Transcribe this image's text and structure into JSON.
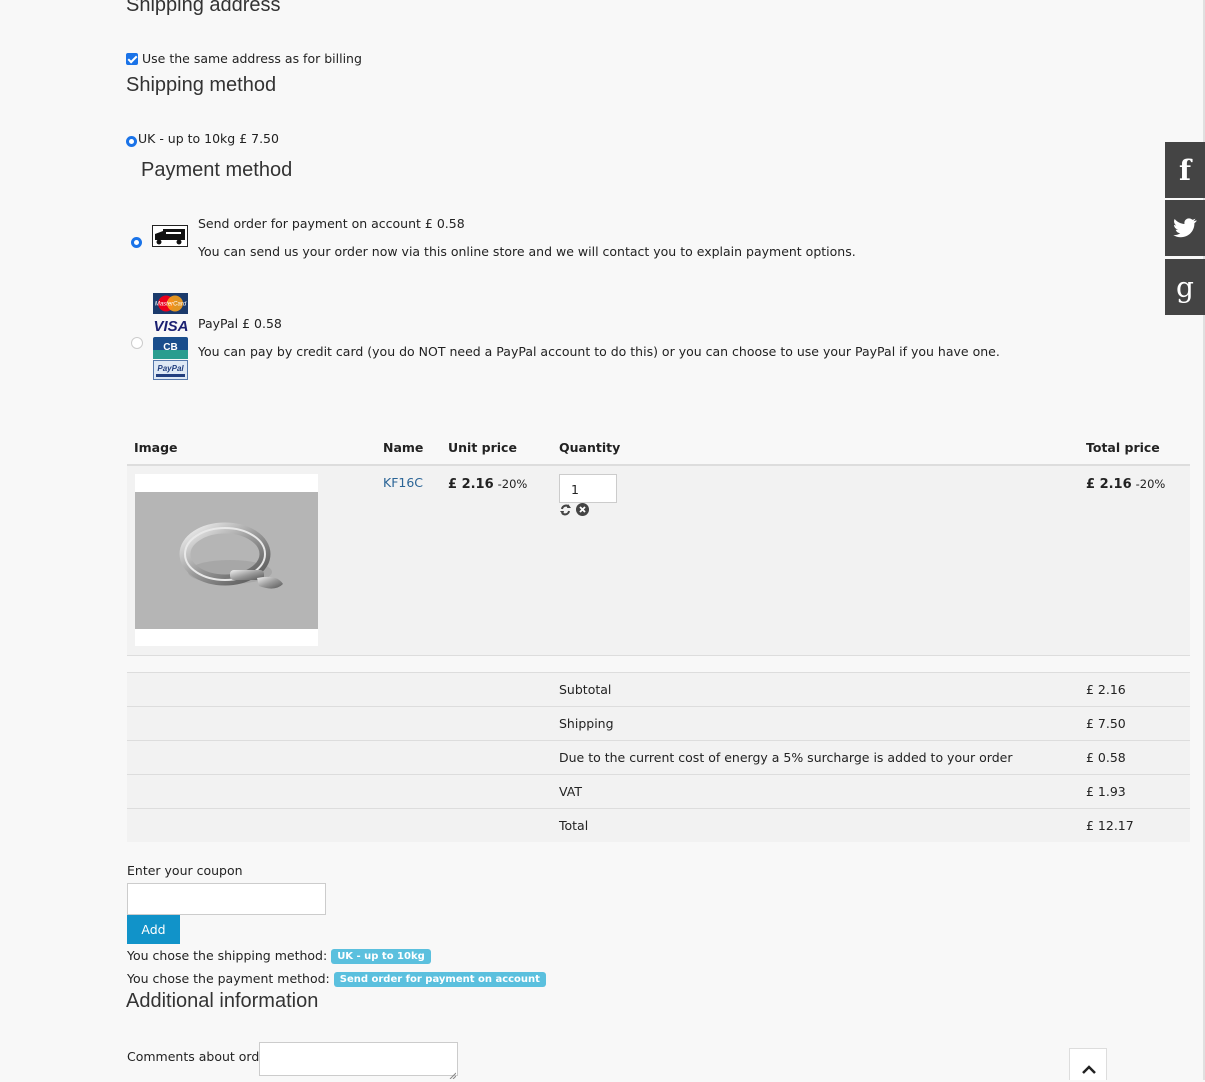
{
  "shipping_address": {
    "heading": "Shipping address",
    "same_as_billing_label": "Use the same address as for billing",
    "same_as_billing_checked": true
  },
  "shipping_method": {
    "heading": "Shipping method",
    "option_label": "UK - up to 10kg £ 7.50",
    "selected": true
  },
  "payment_method": {
    "heading": "Payment method",
    "options": [
      {
        "title": "Send order for payment on account £ 0.58",
        "description": "You can send us your order now via this online store and we will contact you to explain payment options.",
        "icon": "truck-icon",
        "selected": true
      },
      {
        "title": "PayPal £ 0.58",
        "description": "You can pay by credit card (you do NOT need a PayPal account to do this) or you can choose to use your PayPal if you have one.",
        "icons": [
          "mastercard-logo",
          "visa-logo",
          "cb-card-logo",
          "paypal-logo"
        ],
        "logo_text": {
          "mastercard": "MasterCard",
          "visa": "VISA",
          "cb": "CB",
          "paypal": "PayPal"
        },
        "selected": false
      }
    ]
  },
  "cart": {
    "headers": {
      "image": "Image",
      "name": "Name",
      "unit_price": "Unit price",
      "quantity": "Quantity",
      "total_price": "Total price"
    },
    "items": [
      {
        "name": "KF16C",
        "unit_price": "£ 2.16",
        "unit_discount": "-20%",
        "quantity": "1",
        "total_price": "£ 2.16",
        "total_discount": "-20%",
        "icons": [
          "refresh-icon",
          "remove-icon"
        ]
      }
    ],
    "totals": [
      {
        "label": "Subtotal",
        "value": "£ 2.16"
      },
      {
        "label": "Shipping",
        "value": "£ 7.50"
      },
      {
        "label": "Due to the current cost of energy a 5% surcharge is added to your order",
        "value": "£ 0.58"
      },
      {
        "label": "VAT",
        "value": "£ 1.93"
      },
      {
        "label": "Total",
        "value": "£ 12.17"
      }
    ]
  },
  "coupon": {
    "label": "Enter your coupon",
    "value": "",
    "add_button": "Add"
  },
  "summary": {
    "shipping_prefix": "You chose the shipping method:",
    "shipping_badge": "UK - up to 10kg",
    "payment_prefix": "You chose the payment method:",
    "payment_badge": "Send order for payment on account"
  },
  "additional": {
    "heading": "Additional information",
    "comments_label": "Comments about order",
    "comments_value": ""
  },
  "social": {
    "facebook": "f",
    "twitter": "twitter-bird-icon",
    "google": "g"
  },
  "colors": {
    "accent": "#1a73e8",
    "button": "#1193c9",
    "badge": "#5bc0de",
    "social_bg": "#444444",
    "link": "#2a6496"
  }
}
